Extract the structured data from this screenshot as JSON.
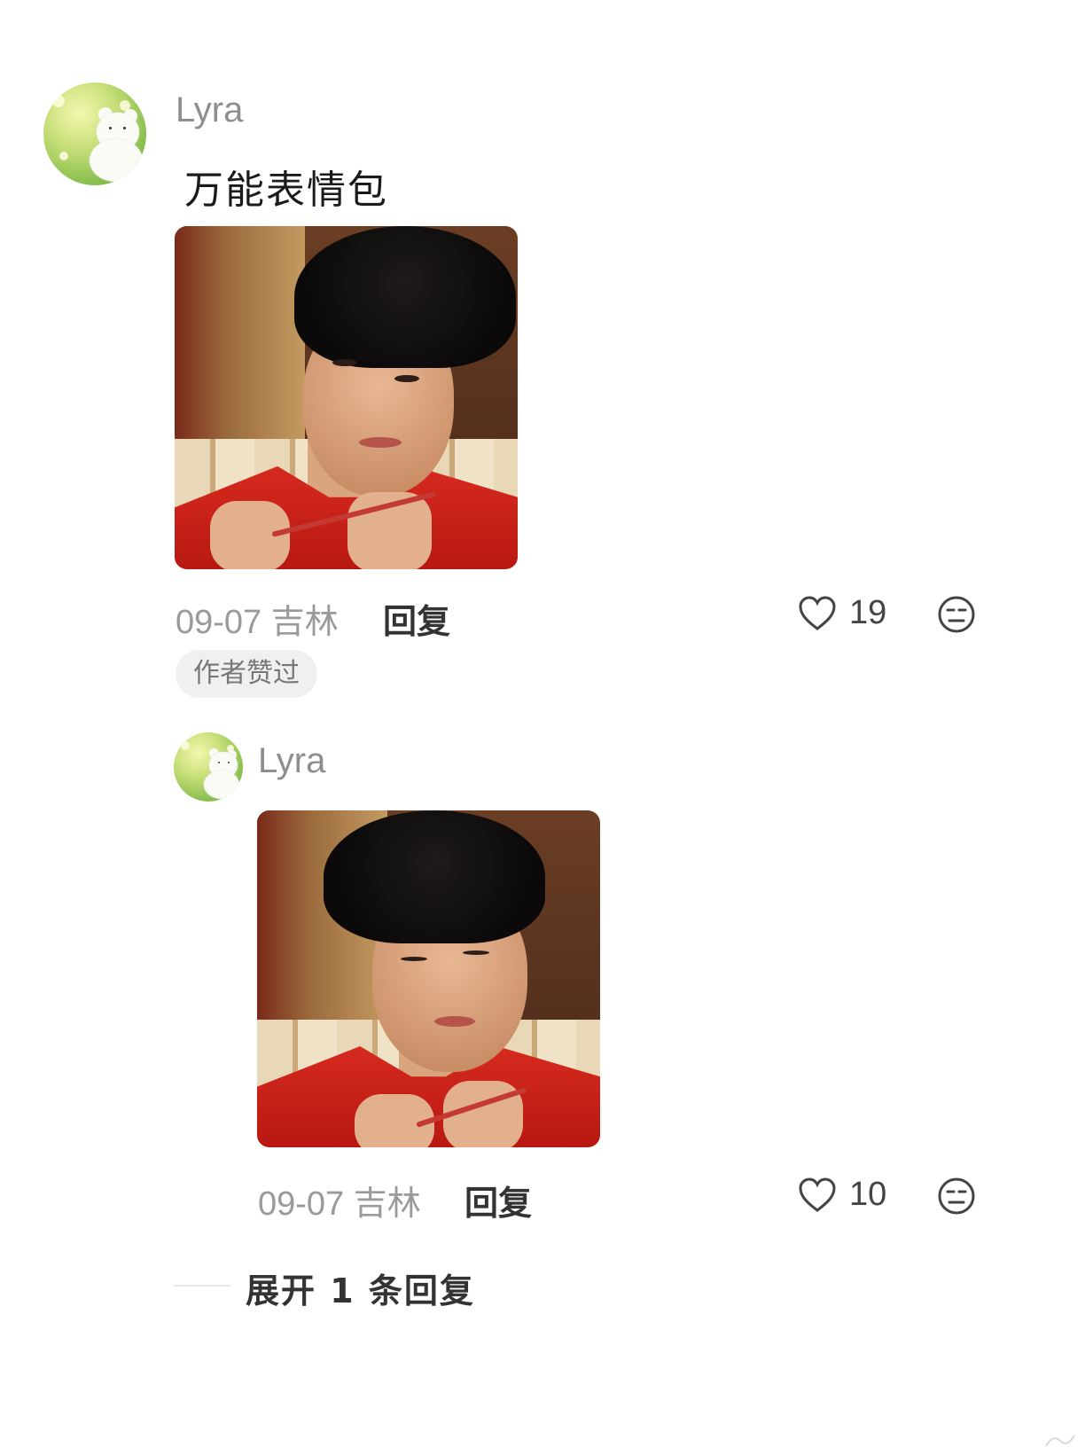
{
  "comment": {
    "username": "Lyra",
    "text": "万能表情包",
    "date_location": "09-07 吉林",
    "reply_label": "回复",
    "likes": "19",
    "badge": "作者赞过"
  },
  "reply": {
    "username": "Lyra",
    "date_location": "09-07 吉林",
    "reply_label": "回复",
    "likes": "10"
  },
  "expand_label": "展开 1 条回复",
  "icons": {
    "like": "heart-outline-icon",
    "more": "neutral-face-icon",
    "avatar": "white-bear-avatar"
  },
  "colors": {
    "username": "#8e8e8e",
    "meta": "#9a9a9a",
    "badge_bg": "#f0f0f0",
    "coat_red": "#d62a1e"
  }
}
